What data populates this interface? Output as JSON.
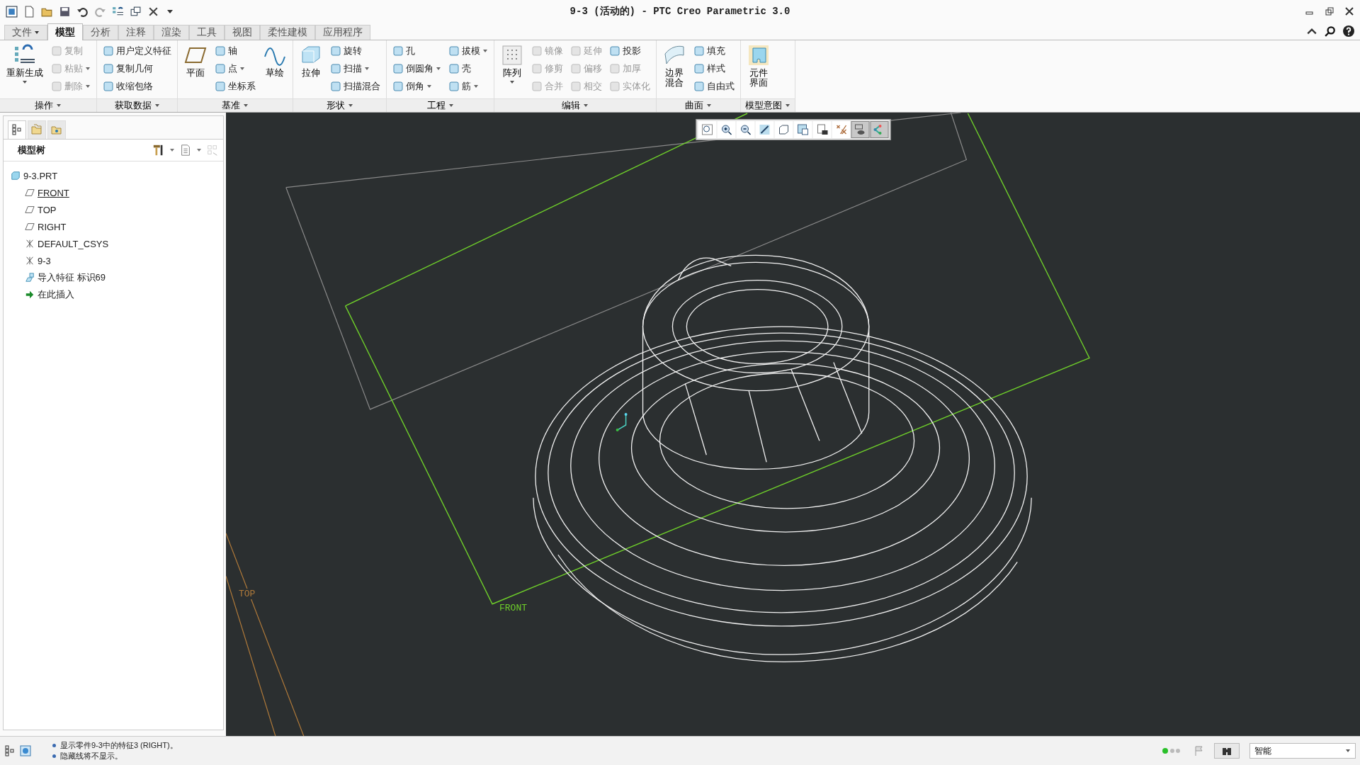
{
  "window": {
    "title": "9-3 (活动的) - PTC Creo Parametric 3.0"
  },
  "tabs": [
    {
      "label": "文件",
      "selected": false,
      "dropdown": true
    },
    {
      "label": "模型",
      "selected": true,
      "dropdown": false
    },
    {
      "label": "分析",
      "selected": false,
      "dropdown": false
    },
    {
      "label": "注释",
      "selected": false,
      "dropdown": false
    },
    {
      "label": "渲染",
      "selected": false,
      "dropdown": false
    },
    {
      "label": "工具",
      "selected": false,
      "dropdown": false
    },
    {
      "label": "视图",
      "selected": false,
      "dropdown": false
    },
    {
      "label": "柔性建模",
      "selected": false,
      "dropdown": false
    },
    {
      "label": "应用程序",
      "selected": false,
      "dropdown": false
    }
  ],
  "ribbon": [
    {
      "label": "操作",
      "columns": [
        {
          "kind": "large",
          "label": "重新生成",
          "dropdown": true
        },
        {
          "kind": "stack",
          "items": [
            {
              "label": "复制",
              "disabled": true,
              "dropdown": false
            },
            {
              "label": "粘贴",
              "disabled": true,
              "dropdown": true
            },
            {
              "label": "删除",
              "disabled": true,
              "dropdown": true
            }
          ]
        }
      ]
    },
    {
      "label": "获取数据",
      "columns": [
        {
          "kind": "stack",
          "items": [
            {
              "label": "用户定义特征",
              "disabled": false,
              "dropdown": false
            },
            {
              "label": "复制几何",
              "disabled": false,
              "dropdown": false
            },
            {
              "label": "收缩包络",
              "disabled": false,
              "dropdown": false
            }
          ]
        }
      ]
    },
    {
      "label": "基准",
      "columns": [
        {
          "kind": "large",
          "label": "平面",
          "dropdown": false
        },
        {
          "kind": "stack",
          "items": [
            {
              "label": "轴",
              "disabled": false,
              "dropdown": false
            },
            {
              "label": "点",
              "disabled": false,
              "dropdown": true
            },
            {
              "label": "坐标系",
              "disabled": false,
              "dropdown": false
            }
          ]
        },
        {
          "kind": "large",
          "label": "草绘",
          "dropdown": false
        }
      ]
    },
    {
      "label": "形状",
      "columns": [
        {
          "kind": "large",
          "label": "拉伸",
          "dropdown": false
        },
        {
          "kind": "stack",
          "items": [
            {
              "label": "旋转",
              "disabled": false,
              "dropdown": false
            },
            {
              "label": "扫描",
              "disabled": false,
              "dropdown": true
            },
            {
              "label": "扫描混合",
              "disabled": false,
              "dropdown": false
            }
          ]
        }
      ]
    },
    {
      "label": "工程",
      "columns": [
        {
          "kind": "stack",
          "items": [
            {
              "label": "孔",
              "disabled": false,
              "dropdown": false
            },
            {
              "label": "倒圆角",
              "disabled": false,
              "dropdown": true
            },
            {
              "label": "倒角",
              "disabled": false,
              "dropdown": true
            }
          ]
        },
        {
          "kind": "stack",
          "items": [
            {
              "label": "拔模",
              "disabled": false,
              "dropdown": true
            },
            {
              "label": "壳",
              "disabled": false,
              "dropdown": false
            },
            {
              "label": "筋",
              "disabled": false,
              "dropdown": true
            }
          ]
        }
      ]
    },
    {
      "label": "编辑",
      "columns": [
        {
          "kind": "large",
          "label": "阵列",
          "dropdown": true
        },
        {
          "kind": "stack",
          "items": [
            {
              "label": "镜像",
              "disabled": true,
              "dropdown": false
            },
            {
              "label": "修剪",
              "disabled": true,
              "dropdown": false
            },
            {
              "label": "合并",
              "disabled": true,
              "dropdown": false
            }
          ]
        },
        {
          "kind": "stack",
          "items": [
            {
              "label": "延伸",
              "disabled": true,
              "dropdown": false
            },
            {
              "label": "偏移",
              "disabled": true,
              "dropdown": false
            },
            {
              "label": "相交",
              "disabled": true,
              "dropdown": false
            }
          ]
        },
        {
          "kind": "stack",
          "items": [
            {
              "label": "投影",
              "disabled": false,
              "dropdown": false
            },
            {
              "label": "加厚",
              "disabled": true,
              "dropdown": false
            },
            {
              "label": "实体化",
              "disabled": true,
              "dropdown": false
            }
          ]
        }
      ]
    },
    {
      "label": "曲面",
      "columns": [
        {
          "kind": "wrapped",
          "label": "边界混合",
          "dropdown": false
        },
        {
          "kind": "stack",
          "items": [
            {
              "label": "填充",
              "disabled": false,
              "dropdown": false
            },
            {
              "label": "样式",
              "disabled": false,
              "dropdown": false
            },
            {
              "label": "自由式",
              "disabled": false,
              "dropdown": false
            }
          ]
        }
      ]
    },
    {
      "label": "模型意图",
      "columns": [
        {
          "kind": "wrapped",
          "label": "元件界面",
          "dropdown": false
        }
      ]
    }
  ],
  "navigator": {
    "tabs": [
      {
        "kind": "tree",
        "selected": true
      },
      {
        "kind": "folder",
        "selected": false
      },
      {
        "kind": "favorites",
        "selected": false
      }
    ],
    "title": "模型树",
    "tree": [
      {
        "label": "9-3.PRT",
        "kind": "part",
        "hovered": false,
        "children": [
          {
            "label": "FRONT",
            "kind": "plane",
            "hovered": true
          },
          {
            "label": "TOP",
            "kind": "plane",
            "hovered": false
          },
          {
            "label": "RIGHT",
            "kind": "plane",
            "hovered": false
          },
          {
            "label": "DEFAULT_CSYS",
            "kind": "csys",
            "hovered": false
          },
          {
            "label": "9-3",
            "kind": "csys",
            "hovered": false
          },
          {
            "label": "导入特征 标识69",
            "kind": "import",
            "hovered": false
          },
          {
            "label": "在此插入",
            "kind": "insert",
            "hovered": false
          }
        ]
      }
    ]
  },
  "view_toolbar": [
    {
      "kind": "refit",
      "selected": false
    },
    {
      "kind": "zoom_in",
      "selected": false
    },
    {
      "kind": "zoom_out",
      "selected": false
    },
    {
      "kind": "repaint",
      "selected": false
    },
    {
      "kind": "orient",
      "selected": false
    },
    {
      "kind": "saved_views",
      "selected": false
    },
    {
      "kind": "display_style",
      "selected": false
    },
    {
      "kind": "datum_display",
      "selected": false
    },
    {
      "kind": "annotation_display",
      "selected": true
    },
    {
      "kind": "spin_center",
      "selected": true
    }
  ],
  "viewport": {
    "labels": [
      {
        "kind": "top",
        "text": "TOP"
      },
      {
        "kind": "front",
        "text": "FRONT"
      }
    ]
  },
  "status_bar": {
    "messages": [
      "显示零件9-3中的特征3 (RIGHT)。",
      "隐藏线将不显示。"
    ],
    "filter": "智能"
  }
}
